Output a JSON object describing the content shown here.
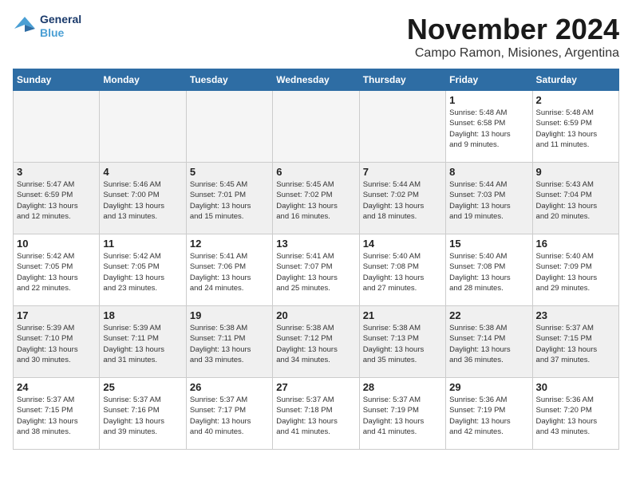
{
  "logo": {
    "line1": "General",
    "line2": "Blue"
  },
  "title": "November 2024",
  "location": "Campo Ramon, Misiones, Argentina",
  "days_of_week": [
    "Sunday",
    "Monday",
    "Tuesday",
    "Wednesday",
    "Thursday",
    "Friday",
    "Saturday"
  ],
  "weeks": [
    [
      {
        "day": "",
        "info": ""
      },
      {
        "day": "",
        "info": ""
      },
      {
        "day": "",
        "info": ""
      },
      {
        "day": "",
        "info": ""
      },
      {
        "day": "",
        "info": ""
      },
      {
        "day": "1",
        "info": "Sunrise: 5:48 AM\nSunset: 6:58 PM\nDaylight: 13 hours\nand 9 minutes."
      },
      {
        "day": "2",
        "info": "Sunrise: 5:48 AM\nSunset: 6:59 PM\nDaylight: 13 hours\nand 11 minutes."
      }
    ],
    [
      {
        "day": "3",
        "info": "Sunrise: 5:47 AM\nSunset: 6:59 PM\nDaylight: 13 hours\nand 12 minutes."
      },
      {
        "day": "4",
        "info": "Sunrise: 5:46 AM\nSunset: 7:00 PM\nDaylight: 13 hours\nand 13 minutes."
      },
      {
        "day": "5",
        "info": "Sunrise: 5:45 AM\nSunset: 7:01 PM\nDaylight: 13 hours\nand 15 minutes."
      },
      {
        "day": "6",
        "info": "Sunrise: 5:45 AM\nSunset: 7:02 PM\nDaylight: 13 hours\nand 16 minutes."
      },
      {
        "day": "7",
        "info": "Sunrise: 5:44 AM\nSunset: 7:02 PM\nDaylight: 13 hours\nand 18 minutes."
      },
      {
        "day": "8",
        "info": "Sunrise: 5:44 AM\nSunset: 7:03 PM\nDaylight: 13 hours\nand 19 minutes."
      },
      {
        "day": "9",
        "info": "Sunrise: 5:43 AM\nSunset: 7:04 PM\nDaylight: 13 hours\nand 20 minutes."
      }
    ],
    [
      {
        "day": "10",
        "info": "Sunrise: 5:42 AM\nSunset: 7:05 PM\nDaylight: 13 hours\nand 22 minutes."
      },
      {
        "day": "11",
        "info": "Sunrise: 5:42 AM\nSunset: 7:05 PM\nDaylight: 13 hours\nand 23 minutes."
      },
      {
        "day": "12",
        "info": "Sunrise: 5:41 AM\nSunset: 7:06 PM\nDaylight: 13 hours\nand 24 minutes."
      },
      {
        "day": "13",
        "info": "Sunrise: 5:41 AM\nSunset: 7:07 PM\nDaylight: 13 hours\nand 25 minutes."
      },
      {
        "day": "14",
        "info": "Sunrise: 5:40 AM\nSunset: 7:08 PM\nDaylight: 13 hours\nand 27 minutes."
      },
      {
        "day": "15",
        "info": "Sunrise: 5:40 AM\nSunset: 7:08 PM\nDaylight: 13 hours\nand 28 minutes."
      },
      {
        "day": "16",
        "info": "Sunrise: 5:40 AM\nSunset: 7:09 PM\nDaylight: 13 hours\nand 29 minutes."
      }
    ],
    [
      {
        "day": "17",
        "info": "Sunrise: 5:39 AM\nSunset: 7:10 PM\nDaylight: 13 hours\nand 30 minutes."
      },
      {
        "day": "18",
        "info": "Sunrise: 5:39 AM\nSunset: 7:11 PM\nDaylight: 13 hours\nand 31 minutes."
      },
      {
        "day": "19",
        "info": "Sunrise: 5:38 AM\nSunset: 7:11 PM\nDaylight: 13 hours\nand 33 minutes."
      },
      {
        "day": "20",
        "info": "Sunrise: 5:38 AM\nSunset: 7:12 PM\nDaylight: 13 hours\nand 34 minutes."
      },
      {
        "day": "21",
        "info": "Sunrise: 5:38 AM\nSunset: 7:13 PM\nDaylight: 13 hours\nand 35 minutes."
      },
      {
        "day": "22",
        "info": "Sunrise: 5:38 AM\nSunset: 7:14 PM\nDaylight: 13 hours\nand 36 minutes."
      },
      {
        "day": "23",
        "info": "Sunrise: 5:37 AM\nSunset: 7:15 PM\nDaylight: 13 hours\nand 37 minutes."
      }
    ],
    [
      {
        "day": "24",
        "info": "Sunrise: 5:37 AM\nSunset: 7:15 PM\nDaylight: 13 hours\nand 38 minutes."
      },
      {
        "day": "25",
        "info": "Sunrise: 5:37 AM\nSunset: 7:16 PM\nDaylight: 13 hours\nand 39 minutes."
      },
      {
        "day": "26",
        "info": "Sunrise: 5:37 AM\nSunset: 7:17 PM\nDaylight: 13 hours\nand 40 minutes."
      },
      {
        "day": "27",
        "info": "Sunrise: 5:37 AM\nSunset: 7:18 PM\nDaylight: 13 hours\nand 41 minutes."
      },
      {
        "day": "28",
        "info": "Sunrise: 5:37 AM\nSunset: 7:19 PM\nDaylight: 13 hours\nand 41 minutes."
      },
      {
        "day": "29",
        "info": "Sunrise: 5:36 AM\nSunset: 7:19 PM\nDaylight: 13 hours\nand 42 minutes."
      },
      {
        "day": "30",
        "info": "Sunrise: 5:36 AM\nSunset: 7:20 PM\nDaylight: 13 hours\nand 43 minutes."
      }
    ]
  ]
}
